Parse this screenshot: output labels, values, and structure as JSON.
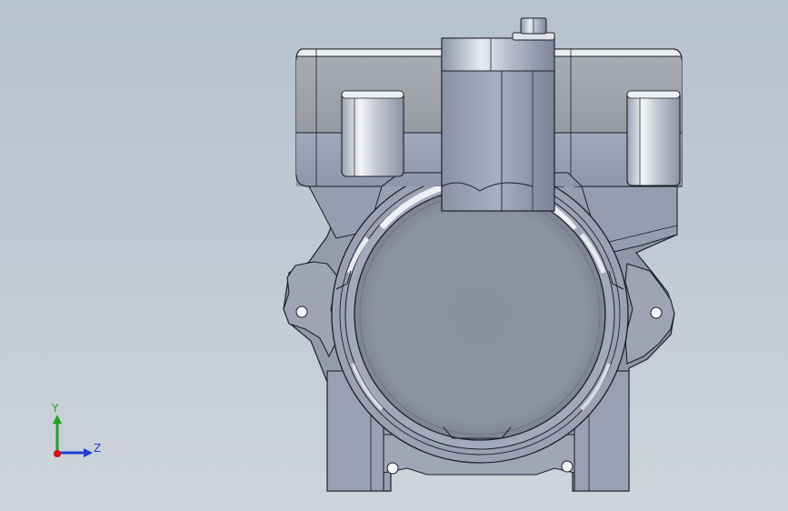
{
  "viewport": {
    "background_top": "#b7c2cf",
    "background_bottom": "#cfd4dc"
  },
  "model": {
    "part_color": "#8e96a6",
    "edge_color": "#1b1f28",
    "highlight_color": "#e6e9ee",
    "shadow_color": "#6f7787"
  },
  "triad": {
    "y_axis": {
      "label": "Y",
      "color": "#1fa31f"
    },
    "z_axis": {
      "label": "Z",
      "color": "#1d3fd0"
    },
    "x_axis": {
      "color": "#d01515"
    }
  }
}
